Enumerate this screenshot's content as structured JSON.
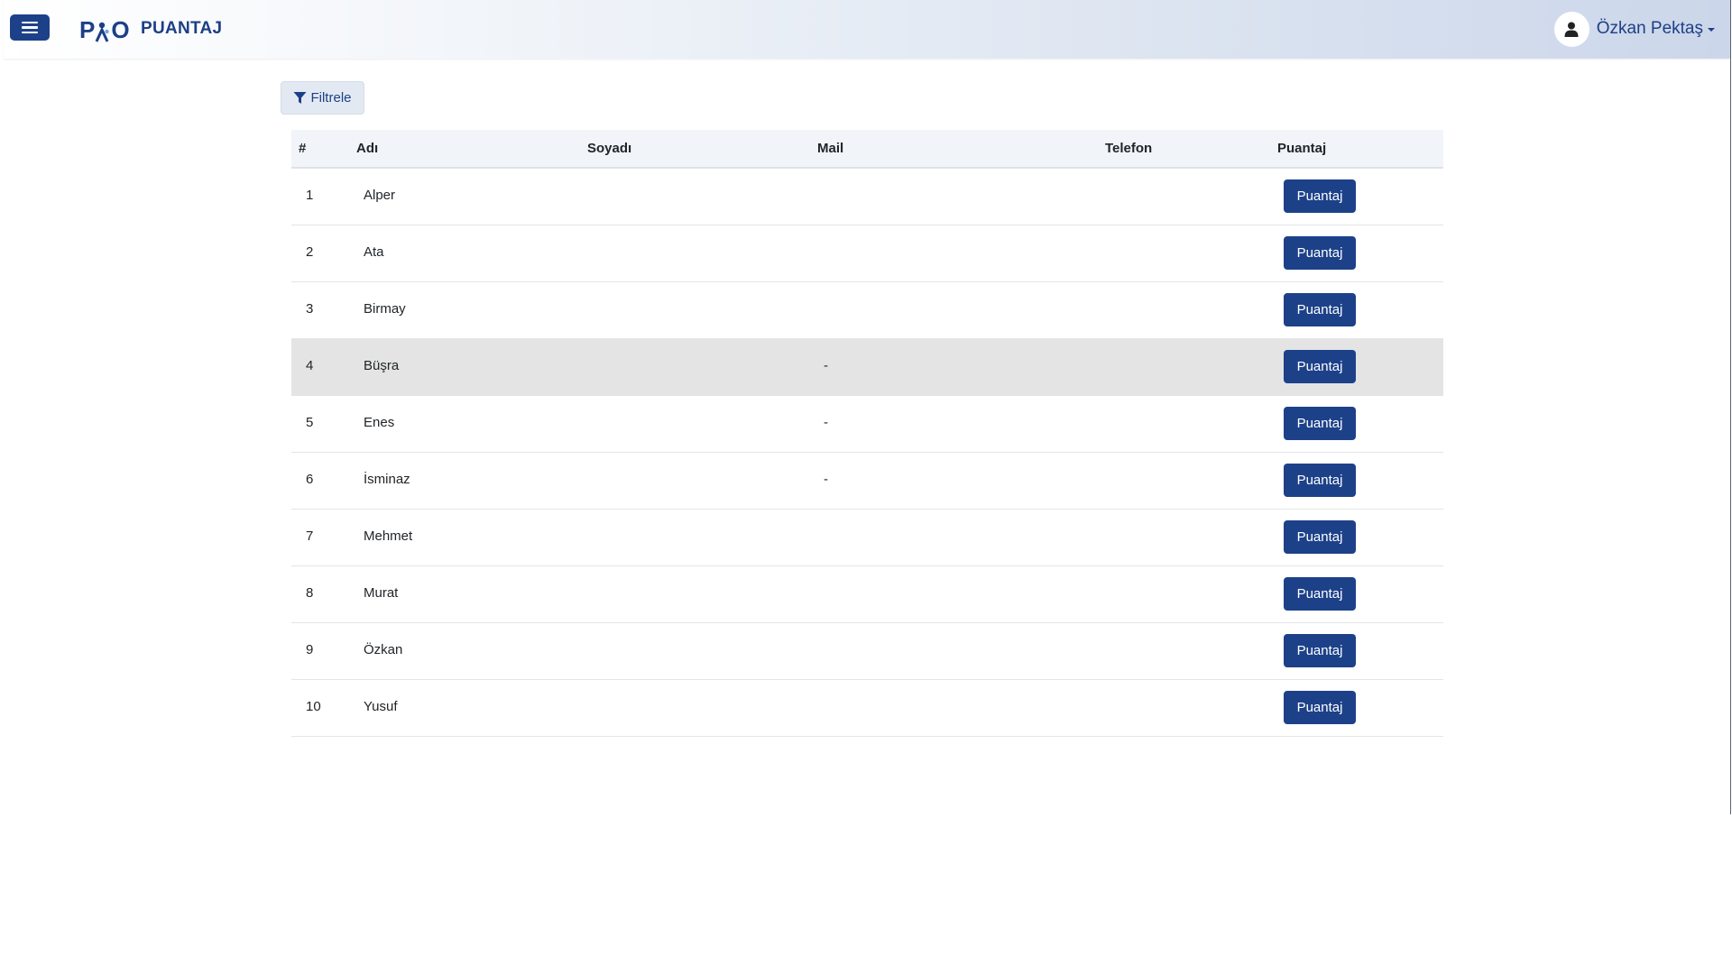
{
  "header": {
    "logo_text_left": "P",
    "logo_text_right": "O",
    "title": "PUANTAJ",
    "user_name": "Özkan Pektaş"
  },
  "filter": {
    "label": "Filtrele"
  },
  "table": {
    "columns": [
      "#",
      "Adı",
      "Soyadı",
      "Mail",
      "Telefon",
      "Puantaj"
    ],
    "rows": [
      {
        "num": "1",
        "ad": "Alper",
        "soyad": "",
        "mail": "",
        "tel": "",
        "button": "Puantaj"
      },
      {
        "num": "2",
        "ad": "Ata",
        "soyad": "",
        "mail": "",
        "tel": "",
        "button": "Puantaj"
      },
      {
        "num": "3",
        "ad": "Birmay",
        "soyad": "",
        "mail": "",
        "tel": "",
        "button": "Puantaj"
      },
      {
        "num": "4",
        "ad": "Büşra",
        "soyad": "",
        "mail": "-",
        "tel": "",
        "button": "Puantaj"
      },
      {
        "num": "5",
        "ad": "Enes",
        "soyad": "",
        "mail": "-",
        "tel": "",
        "button": "Puantaj"
      },
      {
        "num": "6",
        "ad": "İsminaz",
        "soyad": "",
        "mail": "-",
        "tel": "",
        "button": "Puantaj"
      },
      {
        "num": "7",
        "ad": "Mehmet",
        "soyad": "",
        "mail": "",
        "tel": "",
        "button": "Puantaj"
      },
      {
        "num": "8",
        "ad": "Murat",
        "soyad": "",
        "mail": "",
        "tel": "",
        "button": "Puantaj"
      },
      {
        "num": "9",
        "ad": "Özkan",
        "soyad": "",
        "mail": "",
        "tel": "",
        "button": "Puantaj"
      },
      {
        "num": "10",
        "ad": "Yusuf",
        "soyad": "",
        "mail": "",
        "tel": "",
        "button": "Puantaj"
      }
    ],
    "hover_row": "4"
  },
  "colors": {
    "brand": "#1d4189",
    "header_text": "#1d3f86",
    "row_hover": "#e4e4e4"
  }
}
